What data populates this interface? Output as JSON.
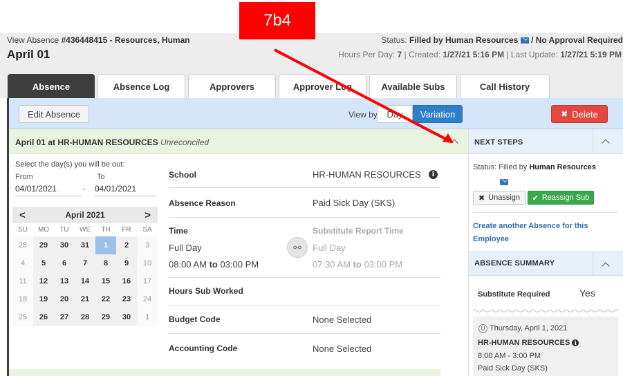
{
  "header": {
    "view_prefix": "View Absence ",
    "absence_id": "#436448415 - Resources, Human",
    "title": "April 01",
    "status_label": "Status: ",
    "status_value": "Filled by Human Resources",
    "approval": " / No Approval Required",
    "hours_label": "Hours Per Day: ",
    "hours_value": "7",
    "created_label": " | Created: ",
    "created_value": "1/27/21 5:16 PM",
    "updated_label": " | Last Update: ",
    "updated_value": "1/27/21 5:19 PM"
  },
  "annotation": {
    "label": "7b4",
    "color": "#ff0000"
  },
  "tabs": [
    {
      "label": "Absence",
      "active": true
    },
    {
      "label": "Absence Log"
    },
    {
      "label": "Approvers"
    },
    {
      "label": "Approver Log"
    },
    {
      "label": "Available Subs"
    },
    {
      "label": "Call History"
    }
  ],
  "toolbar": {
    "edit_label": "Edit Absence",
    "view_by_label": "View by",
    "day_label": "Day",
    "variation_label": "Variation",
    "delete_label": "Delete"
  },
  "absence": {
    "heading": "April 01 at HR-HUMAN RESOURCES",
    "heading_status": "Unreconciled",
    "select_label": "Select the day(s) you will be out:",
    "from_label": "From",
    "to_label": "To",
    "from_value": "04/01/2021",
    "to_value": "04/01/2021",
    "dash": "-",
    "calendar": {
      "month": "April 2021",
      "prev": "<",
      "next": ">",
      "dow": [
        "SU",
        "MO",
        "TU",
        "WE",
        "TH",
        "FR",
        "SA"
      ],
      "days": [
        {
          "d": "28",
          "m": true
        },
        {
          "d": "29"
        },
        {
          "d": "30"
        },
        {
          "d": "31"
        },
        {
          "d": "1",
          "s": true
        },
        {
          "d": "2"
        },
        {
          "d": "3",
          "m": true
        },
        {
          "d": "4",
          "m": true
        },
        {
          "d": "5"
        },
        {
          "d": "6"
        },
        {
          "d": "7"
        },
        {
          "d": "8"
        },
        {
          "d": "9"
        },
        {
          "d": "10",
          "m": true
        },
        {
          "d": "11",
          "m": true
        },
        {
          "d": "12"
        },
        {
          "d": "13"
        },
        {
          "d": "14"
        },
        {
          "d": "15"
        },
        {
          "d": "16"
        },
        {
          "d": "17",
          "m": true
        },
        {
          "d": "18",
          "m": true
        },
        {
          "d": "19"
        },
        {
          "d": "20"
        },
        {
          "d": "21"
        },
        {
          "d": "22"
        },
        {
          "d": "23"
        },
        {
          "d": "24",
          "m": true
        },
        {
          "d": "25",
          "m": true
        },
        {
          "d": "26"
        },
        {
          "d": "27"
        },
        {
          "d": "28"
        },
        {
          "d": "29"
        },
        {
          "d": "30"
        },
        {
          "d": "1",
          "m": true
        }
      ]
    },
    "fields": {
      "school_label": "School",
      "school_value": "HR-HUMAN RESOURCES",
      "reason_label": "Absence Reason",
      "reason_value": "Paid Sick Day (SKS)",
      "time_label": "Time",
      "sub_time_label": "Substitute Report Time",
      "time_value": "Full Day",
      "sub_time_value": "Full Day",
      "time_from": "08:00 AM",
      "to_word": "to",
      "time_to": "03:00 PM",
      "sub_from": "07:30 AM",
      "sub_to": "03:00 PM",
      "hours_label": "Hours Sub Worked",
      "budget_label": "Budget Code",
      "budget_value": "None Selected",
      "accounting_label": "Accounting Code",
      "accounting_value": "None Selected"
    }
  },
  "next_steps": {
    "title": "NEXT STEPS",
    "status_prefix": "Status: Filled by ",
    "status_name": "Human Resources",
    "unassign_label": "Unassign",
    "reassign_label": "Reassign Sub",
    "create_link": "Create another Absence for this Employee"
  },
  "summary": {
    "title": "ABSENCE SUMMARY",
    "sub_required_label": "Substitute Required",
    "sub_required_value": "Yes",
    "badge": "U",
    "date": "Thursday, April 1, 2021",
    "location": "HR-HUMAN RESOURCES",
    "time": "8:00 AM - 3:00 PM",
    "reason": "Paid Sick Day (SKS)"
  }
}
